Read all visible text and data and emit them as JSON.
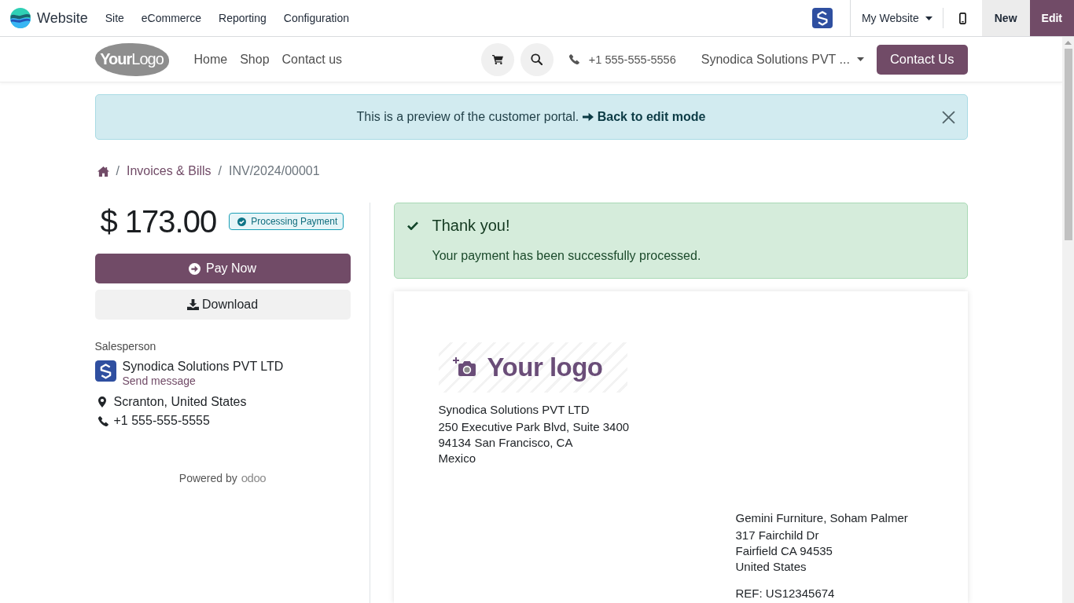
{
  "top_bar": {
    "app_name": "Website",
    "menu": [
      "Site",
      "eCommerce",
      "Reporting",
      "Configuration"
    ],
    "website_selector": "My Website",
    "actions": [
      {
        "label": "New",
        "kind": "secondary"
      },
      {
        "label": "Edit",
        "kind": "primary"
      }
    ]
  },
  "site_header": {
    "logo": "**Your**Logo",
    "nav": [
      "Home",
      "Shop",
      "Contact us"
    ],
    "phone": "+1 555-555-5556",
    "company_selector": "Synodica Solutions PVT ...",
    "contact_button": "Contact Us"
  },
  "preview_alert": {
    "text": "This is a preview of the customer portal.",
    "link": "Back to edit mode"
  },
  "breadcrumb": [
    {
      "kind": "home"
    },
    {
      "kind": "separator",
      "label": "/"
    },
    {
      "kind": "link",
      "label": "Invoices & Bills"
    },
    {
      "kind": "separator",
      "label": "/"
    },
    {
      "kind": "current",
      "label": "INV/2024/00001"
    }
  ],
  "summary": {
    "amount": "$ 173.00",
    "status": "Processing Payment",
    "buttons": [
      {
        "label": "Pay Now",
        "kind": "pay"
      },
      {
        "label": "Download",
        "kind": "download"
      }
    ],
    "salesperson_heading": "Salesperson",
    "salesperson": {
      "name": "Synodica Solutions PVT LTD",
      "link": "Send message"
    },
    "contact": [
      {
        "kind": "location",
        "text": "Scranton, United States"
      },
      {
        "kind": "phone",
        "text": "+1 555-555-5555"
      }
    ],
    "powered_by": "Powered by",
    "powered_brand": "odoo"
  },
  "success_alert": {
    "title": "Thank you!",
    "message": "Your payment has been successfully processed."
  },
  "invoice": {
    "logo_placeholder": "Your logo",
    "company_address": [
      "Synodica Solutions PVT LTD",
      "250 Executive Park Blvd, Suite 3400",
      "94134 San Francisco, CA",
      "Mexico"
    ],
    "customer_address": [
      "Gemini Furniture, Soham Palmer",
      "317 Fairchild Dr",
      "Fairfield CA 94535",
      "United States"
    ],
    "reference": "REF: US12345674"
  }
}
